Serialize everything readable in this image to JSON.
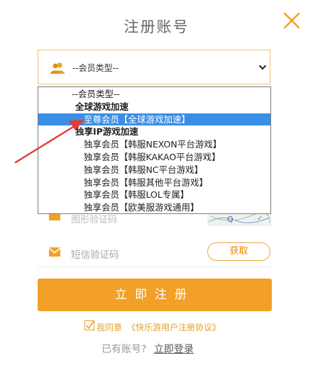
{
  "header": {
    "title": "注册账号"
  },
  "member_type": {
    "selected_value": "--会员类型--"
  },
  "dropdown": {
    "options": [
      {
        "label": "--会员类型--",
        "kind": "placeholder"
      },
      {
        "label": "全球游戏加速",
        "kind": "group"
      },
      {
        "label": "至尊会员【全球游戏加速】",
        "kind": "item",
        "selected": true
      },
      {
        "label": "独享IP游戏加速",
        "kind": "group"
      },
      {
        "label": "独享会员【韩服NEXON平台游戏】",
        "kind": "item"
      },
      {
        "label": "独享会员【韩服KAKAO平台游戏】",
        "kind": "item"
      },
      {
        "label": "独享会员【韩服NC平台游戏】",
        "kind": "item"
      },
      {
        "label": "独享会员【韩服其他平台游戏】",
        "kind": "item"
      },
      {
        "label": "独享会员【韩服LOL专属】",
        "kind": "item"
      },
      {
        "label": "独享会员【欧美服游戏通用】",
        "kind": "item"
      }
    ]
  },
  "captcha_row": {
    "placeholder": "图形验证码"
  },
  "sms_row": {
    "placeholder": "短信验证码",
    "get_button": "获取"
  },
  "register_button": "立即注册",
  "agreement": {
    "prefix": "我同意",
    "link": "《快乐游用户注册协议》"
  },
  "login": {
    "prompt": "已有账号?",
    "link": "立即登录"
  },
  "colors": {
    "accent": "#f2a027",
    "selected_option": "#3a8ee6",
    "annotation_arrow": "#e53935"
  }
}
